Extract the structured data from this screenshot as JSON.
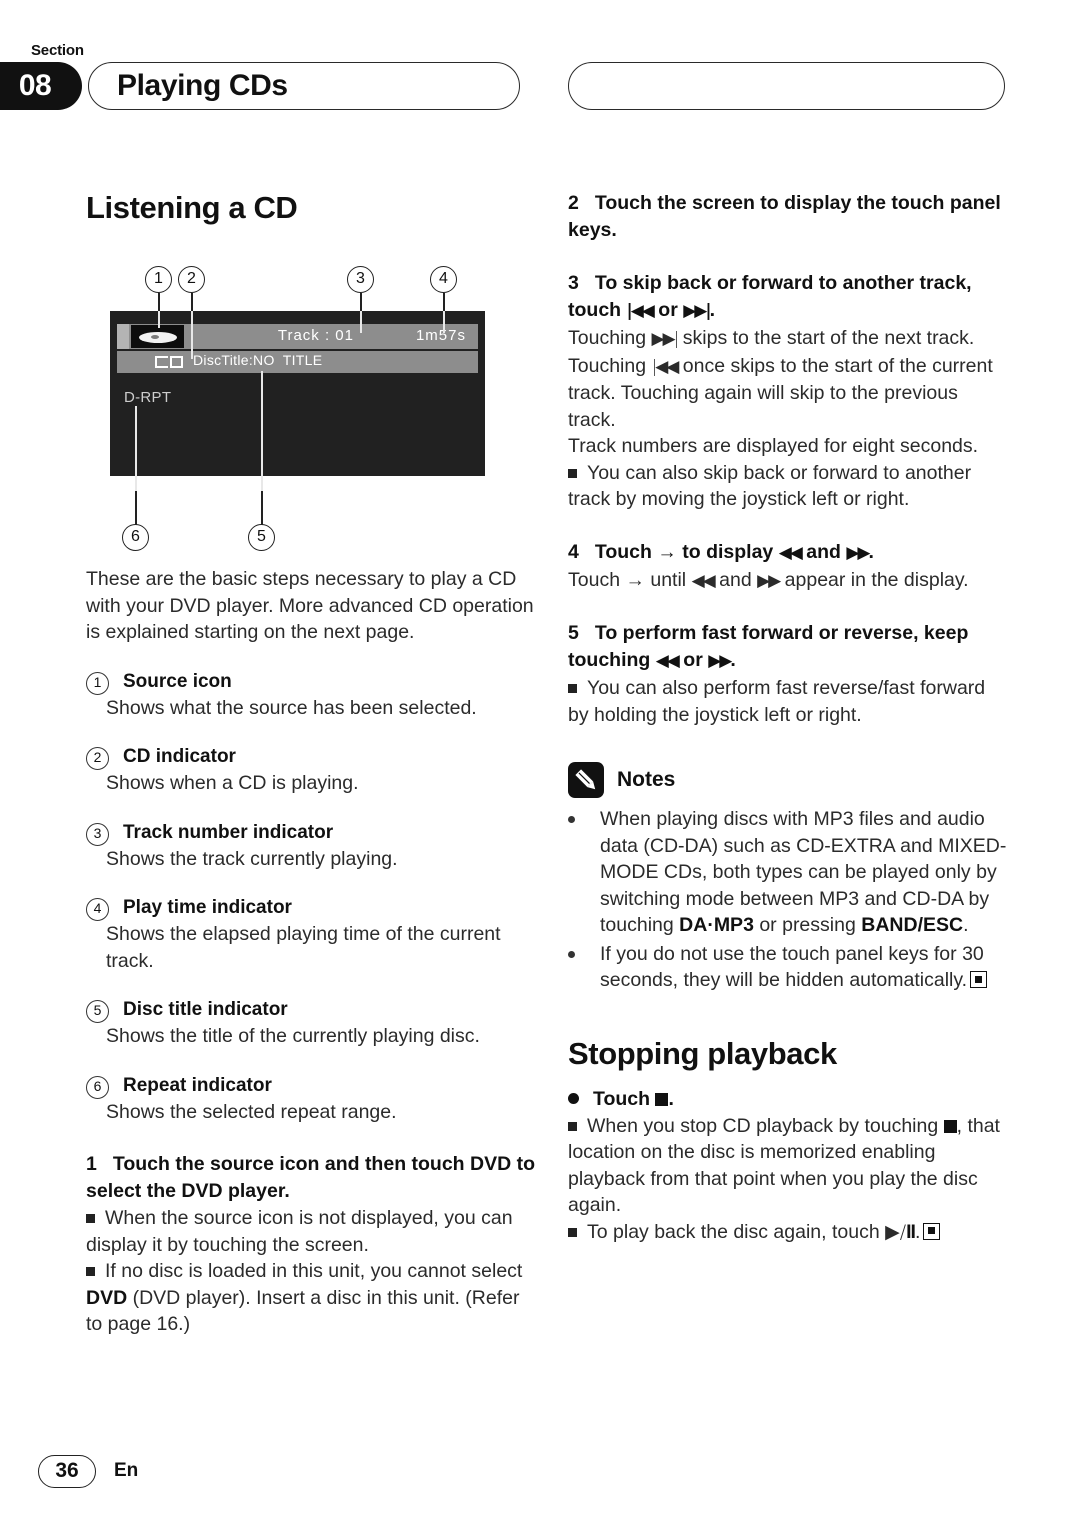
{
  "header": {
    "section_label": "Section",
    "section_number": "08",
    "title": "Playing CDs"
  },
  "left_column": {
    "heading": "Listening a CD",
    "diagram": {
      "callouts": [
        "1",
        "2",
        "3",
        "4",
        "5",
        "6"
      ],
      "display": {
        "track_label": "Track : 01",
        "time_label": "1m57s",
        "disc_title": "DiscTitle:NO  TITLE",
        "repeat_indicator": "D-RPT"
      }
    },
    "intro": "These are the basic steps necessary to play a CD with your DVD player. More advanced CD operation is explained starting on the next page.",
    "items": [
      {
        "num": "1",
        "title": "Source icon",
        "desc": "Shows what the source has been selected."
      },
      {
        "num": "2",
        "title": "CD indicator",
        "desc": "Shows when a CD is playing."
      },
      {
        "num": "3",
        "title": "Track number indicator",
        "desc": "Shows the track currently playing."
      },
      {
        "num": "4",
        "title": "Play time indicator",
        "desc": "Shows the elapsed playing time of the current track."
      },
      {
        "num": "5",
        "title": "Disc title indicator",
        "desc": "Shows the title of the currently playing disc."
      },
      {
        "num": "6",
        "title": "Repeat indicator",
        "desc": "Shows the selected repeat range."
      }
    ],
    "step1": {
      "number": "1",
      "head": "Touch the source icon and then touch DVD to select the DVD player.",
      "note1": "When the source icon is not displayed, you can display it by touching the screen.",
      "note2_pre": "If no disc is loaded in this unit, you cannot select ",
      "note2_bold": "DVD",
      "note2_post": " (DVD player). Insert a disc in this unit. (Refer to page 16.)"
    }
  },
  "right_column": {
    "step2": {
      "number": "2",
      "head": "Touch the screen to display the touch panel keys."
    },
    "step3": {
      "number": "3",
      "head_pre": "To skip back or forward to another track, touch ",
      "head_icon_back": "|◀◀",
      "head_mid": " or ",
      "head_icon_fwd": "▶▶|",
      "head_post": ".",
      "body_1": "Touching ",
      "body_icon_fwd": "▶▶|",
      "body_2": " skips to the start of the next track. Touching ",
      "body_icon_back": "|◀◀",
      "body_3": " once skips to the start of the current track. Touching again will skip to the previous track.",
      "body_4": "Track numbers are displayed for eight seconds.",
      "note": "You can also skip back or forward to another track by moving the joystick left or right."
    },
    "step4": {
      "number": "4",
      "head_pre": "Touch ",
      "head_arrow": "→",
      "head_mid": " to display ",
      "head_rev": "◀◀",
      "head_and": " and ",
      "head_fwd": "▶▶",
      "head_post": ".",
      "body_pre": "Touch ",
      "body_arrow": "→",
      "body_mid": " until ",
      "body_rev": "◀◀",
      "body_and": " and ",
      "body_fwd": "▶▶",
      "body_post": " appear in the display."
    },
    "step5": {
      "number": "5",
      "head_pre": "To perform fast forward or reverse, keep touching ",
      "head_rev": "◀◀",
      "head_mid": " or ",
      "head_fwd": "▶▶",
      "head_post": ".",
      "note": "You can also perform fast reverse/fast forward by holding the joystick left or right."
    },
    "notes": {
      "label": "Notes",
      "items": [
        {
          "pre": "When playing discs with MP3 files and audio data (CD-DA) such as CD-EXTRA and MIXED-MODE CDs, both types can be played only by switching mode between MP3 and CD-DA by touching ",
          "bold1": "DA·MP3",
          "mid": " or pressing ",
          "bold2": "BAND/ESC",
          "post": ".",
          "has_end_mark": false
        },
        {
          "pre": "If you do not use the touch panel keys for 30 seconds, they will be hidden automatically.",
          "bold1": "",
          "mid": "",
          "bold2": "",
          "post": "",
          "has_end_mark": true
        }
      ]
    },
    "stopping": {
      "heading": "Stopping playback",
      "action_pre": "Touch ",
      "action_post": ".",
      "note1_pre": "When you stop CD playback by touching ",
      "note1_post": ", that location on the disc is memorized enabling playback from that point when you play the disc again.",
      "note2_pre": "To play back the disc again, touch ",
      "note2_glyph": "▶/",
      "note2_post": "."
    }
  },
  "footer": {
    "page_number": "36",
    "language": "En"
  }
}
